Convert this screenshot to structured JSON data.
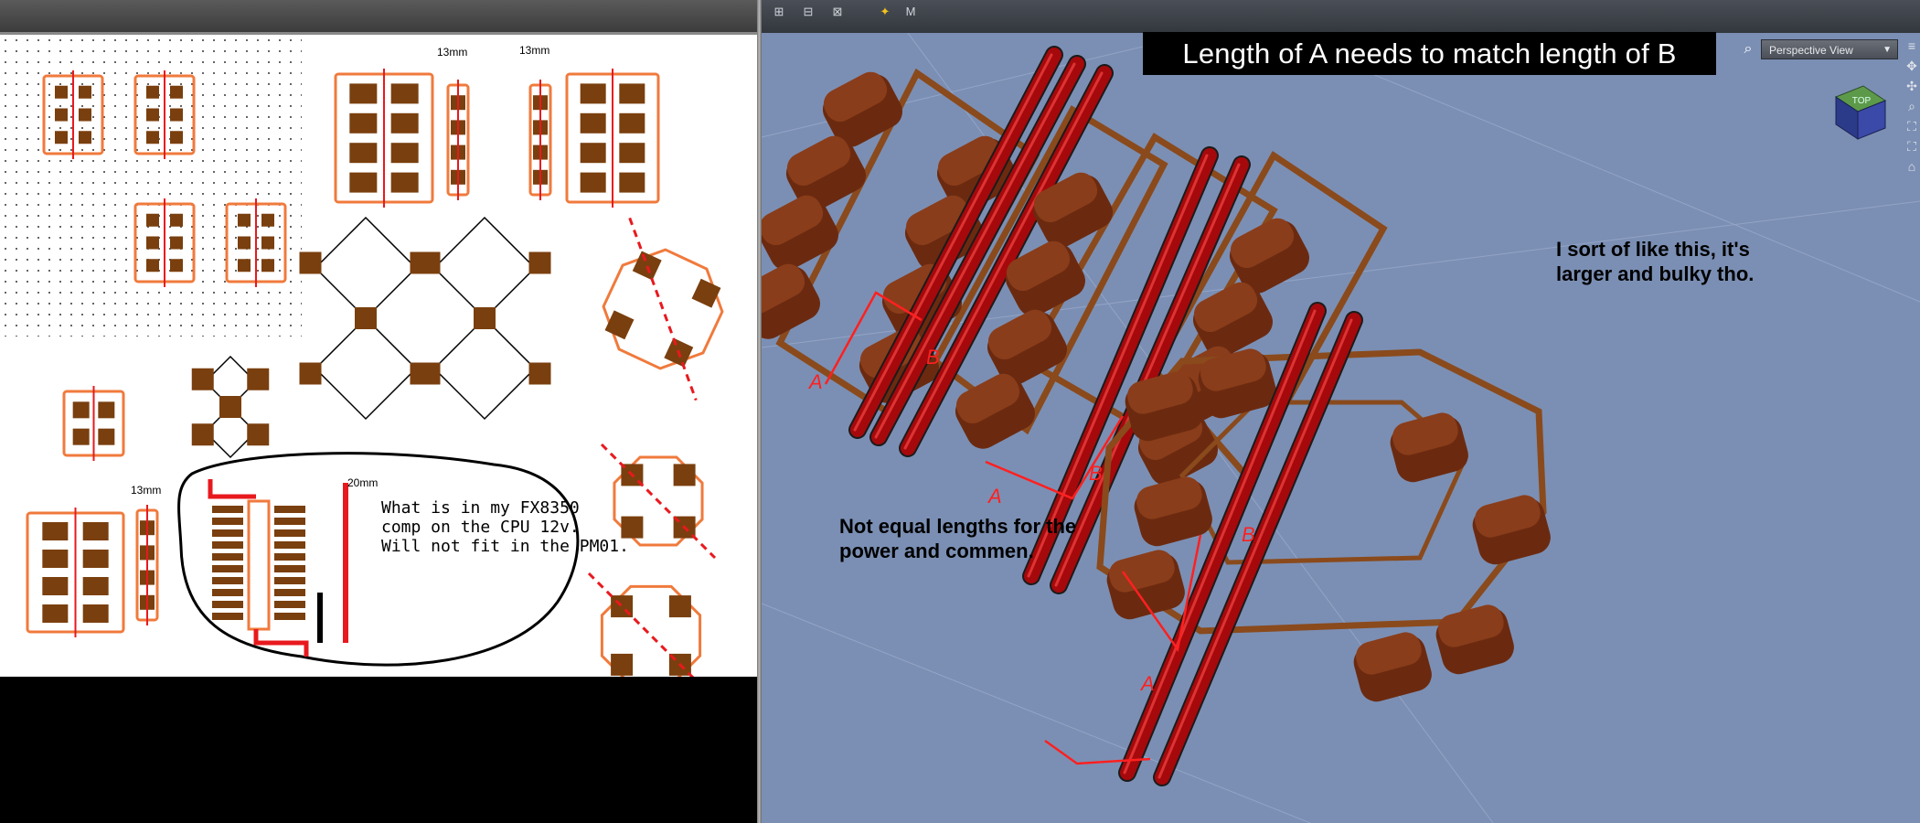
{
  "pcb_panel": {
    "note": "What is in my FX8350\ncomp on the CPU 12v.\nWill not fit in the PM01.",
    "dimensions": [
      "13mm",
      "13mm",
      "13mm",
      "20mm"
    ]
  },
  "viewport": {
    "banner": "Length of A needs to match length of B",
    "view_mode": "Perspective View",
    "cube_label": "TOP",
    "note_left": "Not equal lengths for the\npower and commen.",
    "note_right": "I sort of like this, it's\nlarger and bulky tho.",
    "markers": {
      "a": "A",
      "b": "B"
    }
  },
  "colors": {
    "pad": "#7a3f0e",
    "outline": "#f07a3c",
    "trace_red": "#e8191e",
    "viewport_bg": "#7b8fb4",
    "cap_body": "#6b2a10",
    "post_red": "#a5090c"
  }
}
